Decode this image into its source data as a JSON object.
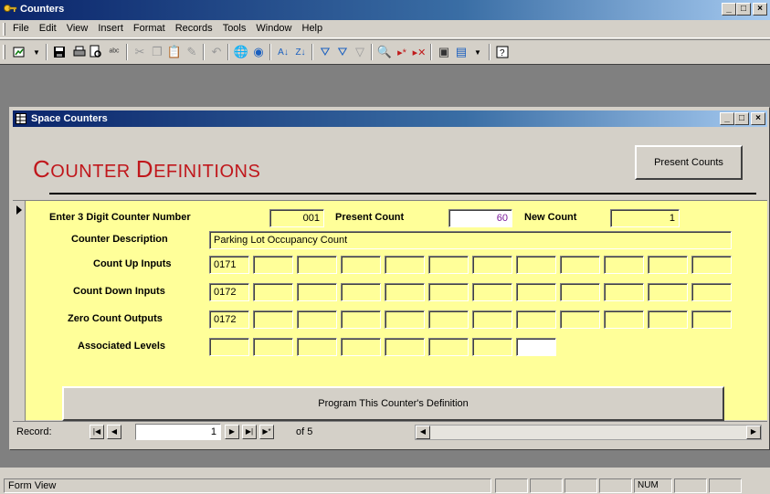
{
  "app": {
    "title": "Counters",
    "window_buttons": [
      "_",
      "□",
      "×"
    ]
  },
  "menu": [
    "File",
    "Edit",
    "View",
    "Insert",
    "Format",
    "Records",
    "Tools",
    "Window",
    "Help"
  ],
  "toolbar_icons": [
    "view-icon",
    "save-icon",
    "print-icon",
    "print-preview-icon",
    "spelling-icon",
    "cut-icon",
    "copy-icon",
    "paste-icon",
    "format-painter-icon",
    "undo-icon",
    "hyperlink-icon",
    "web-icon",
    "sort-ascending-icon",
    "sort-descending-icon",
    "filter-by-selection-icon",
    "filter-by-form-icon",
    "apply-filter-icon",
    "find-icon",
    "new-record-icon",
    "delete-record-icon",
    "database-window-icon",
    "new-object-icon",
    "help-icon"
  ],
  "child": {
    "title": "Space Counters"
  },
  "form": {
    "title_first_C": "C",
    "title_ounter": "OUNTER ",
    "title_D": "D",
    "title_efinitions": "EFINITIONS",
    "present_counts_label": "Present Counts",
    "counter_number_label": "Enter 3 Digit Counter Number",
    "counter_number_value": "001",
    "present_count_label": "Present Count",
    "present_count_value": "60",
    "new_count_label": "New Count",
    "new_count_value": "1",
    "description_label": "Counter Description",
    "description_value": "Parking Lot Occupancy Count",
    "count_up_label": "Count Up Inputs",
    "count_up_values": [
      "0171",
      "",
      "",
      "",
      "",
      "",
      "",
      "",
      "",
      "",
      "",
      "",
      ""
    ],
    "count_down_label": "Count Down Inputs",
    "count_down_values": [
      "0172",
      "",
      "",
      "",
      "",
      "",
      "",
      "",
      "",
      "",
      "",
      "",
      ""
    ],
    "zero_count_label": "Zero Count Outputs",
    "zero_count_values": [
      "0172",
      "",
      "",
      "",
      "",
      "",
      "",
      "",
      "",
      "",
      "",
      "",
      ""
    ],
    "associated_levels_label": "Associated Levels",
    "associated_levels_values": [
      "",
      "",
      "",
      "",
      "",
      "",
      "",
      ""
    ],
    "program_button_label": "Program This Counter's Definition"
  },
  "navigation": {
    "record_label": "Record:",
    "current_record": "1",
    "of_label": "of  5"
  },
  "status": {
    "text": "Form View",
    "num": "NUM"
  }
}
